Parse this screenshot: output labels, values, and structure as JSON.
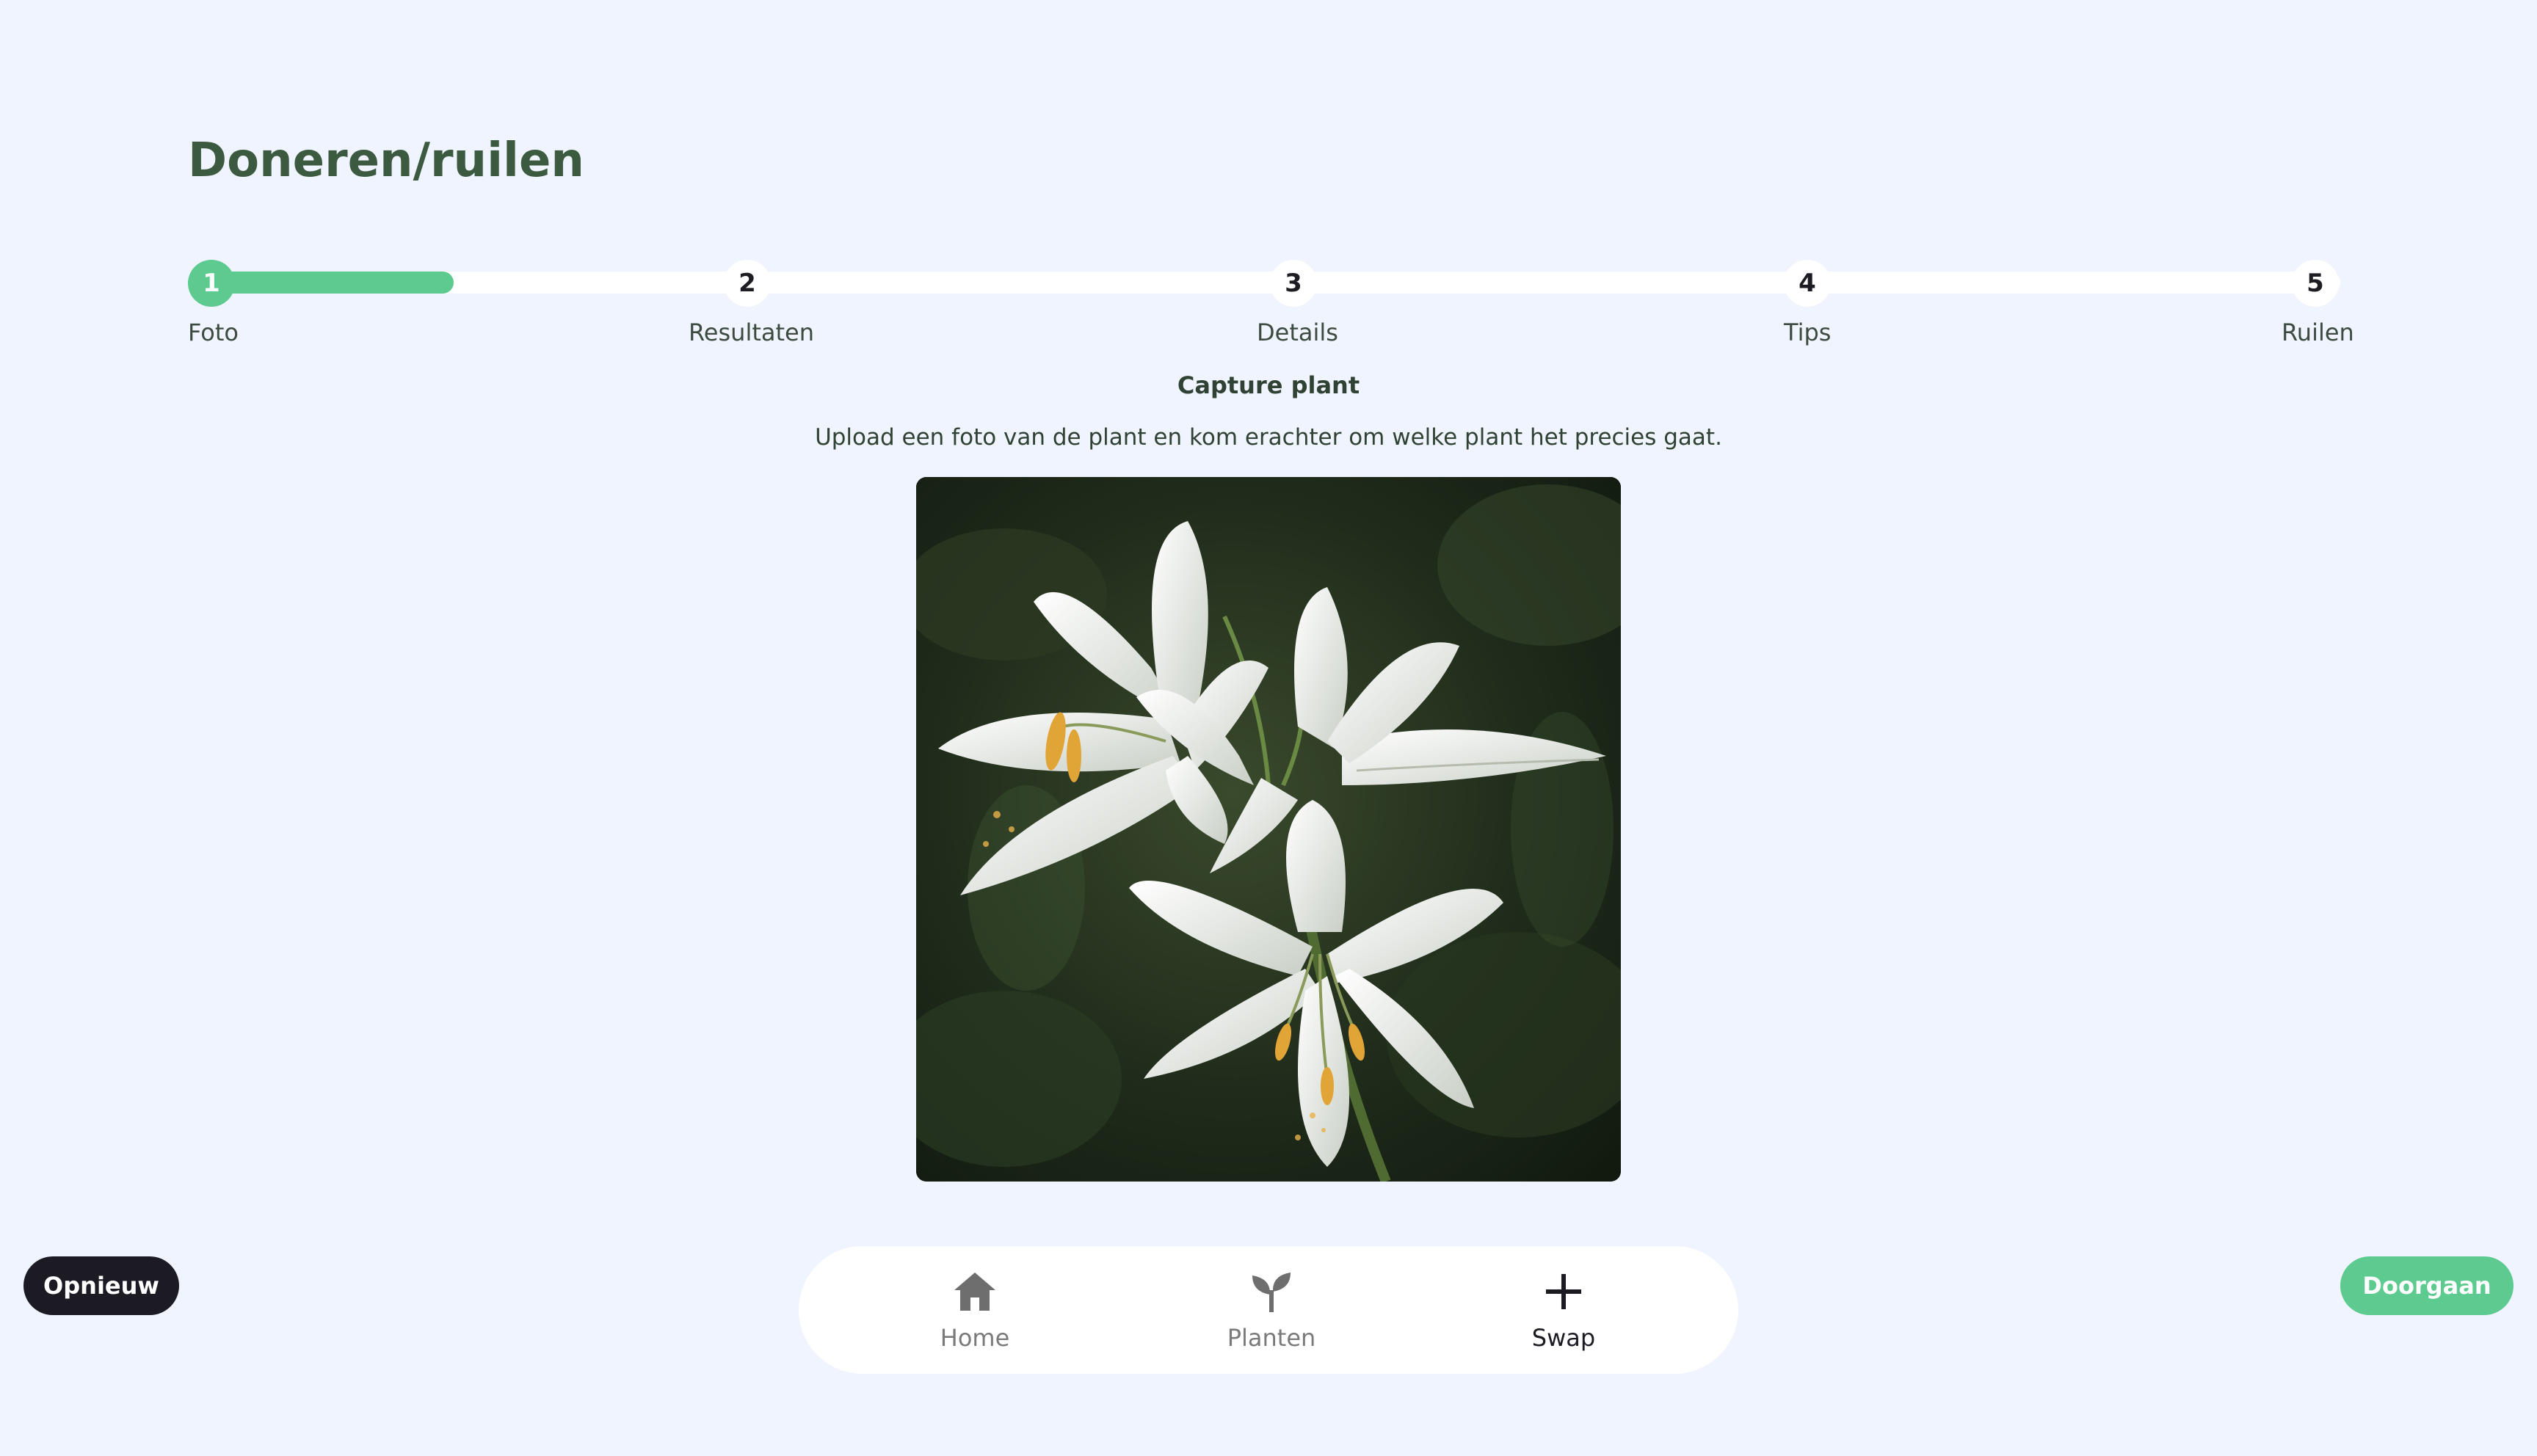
{
  "page": {
    "title": "Doneren/ruilen"
  },
  "steps": [
    {
      "number": "1",
      "label": "Foto"
    },
    {
      "number": "2",
      "label": "Resultaten"
    },
    {
      "number": "3",
      "label": "Details"
    },
    {
      "number": "4",
      "label": "Tips"
    },
    {
      "number": "5",
      "label": "Ruilen"
    }
  ],
  "progress": {
    "current_step": 1,
    "fill_fraction": 0.12
  },
  "content": {
    "heading": "Capture plant",
    "description": "Upload een foto van de plant en kom erachter om welke plant het precies gaat."
  },
  "actions": {
    "reset_label": "Opnieuw",
    "continue_label": "Doorgaan"
  },
  "nav": {
    "items": [
      {
        "label": "Home",
        "icon": "home-icon"
      },
      {
        "label": "Planten",
        "icon": "sprout-icon"
      },
      {
        "label": "Swap",
        "icon": "plus-icon"
      }
    ],
    "active": "Swap"
  },
  "colors": {
    "accent": "#5dca8f",
    "title": "#3b5a40",
    "background": "#f0f4fe",
    "dark_button": "#1c1b24"
  }
}
